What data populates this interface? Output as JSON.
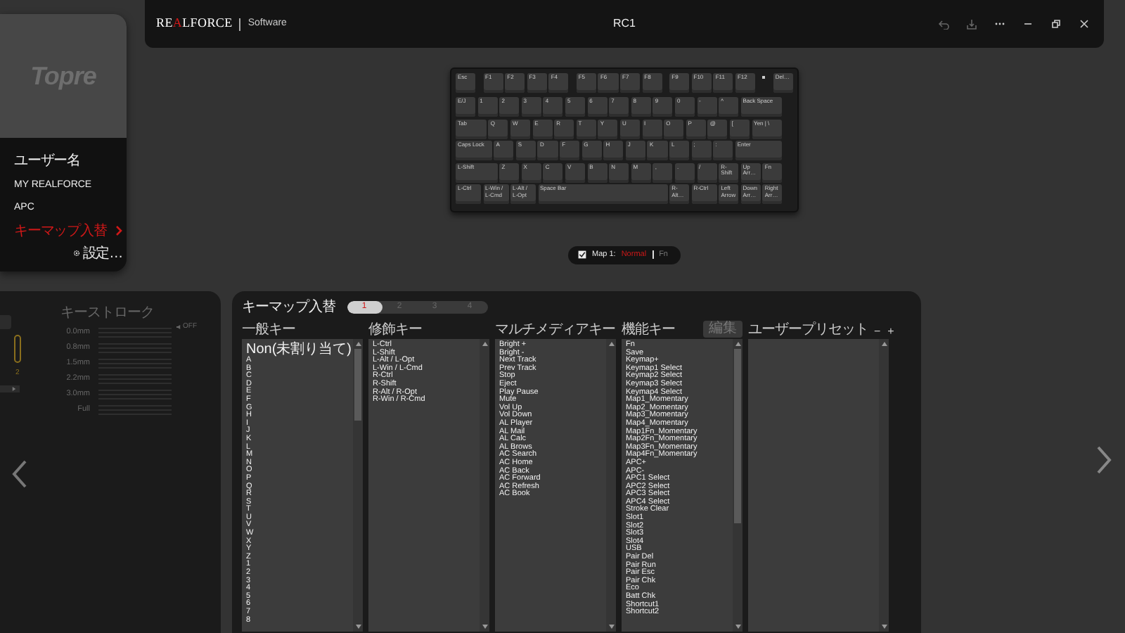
{
  "menu": {
    "logo": "Topre",
    "items": [
      {
        "label": "ユーザー名",
        "kind": "user",
        "selected": false
      },
      {
        "label": "MY REALFORCE",
        "kind": "link",
        "selected": false
      },
      {
        "label": "APC",
        "kind": "link",
        "selected": false
      },
      {
        "label": "キーマップ入替",
        "kind": "link",
        "selected": true
      },
      {
        "label": "設定…",
        "kind": "settings",
        "selected": false
      }
    ]
  },
  "title_bar": {
    "brand": [
      {
        "text": "RE",
        "accent": false
      },
      {
        "text": "A",
        "accent": true
      },
      {
        "text": "LFORCE",
        "accent": false
      }
    ],
    "product": "Software",
    "title": "RC1"
  },
  "keyboard": {
    "rows": [
      {
        "groups": [
          [
            {
              "label": "Esc",
              "kind": "key"
            }
          ],
          [
            {
              "label": "F1",
              "kind": "key"
            },
            {
              "label": "F2",
              "kind": "key"
            },
            {
              "label": "F3",
              "kind": "key"
            },
            {
              "label": "F4",
              "kind": "key"
            }
          ],
          [
            {
              "label": "F5",
              "kind": "key"
            },
            {
              "label": "F6",
              "kind": "key"
            },
            {
              "label": "F7",
              "kind": "key"
            },
            {
              "label": "F8",
              "kind": "key"
            }
          ],
          [
            {
              "label": "F9",
              "kind": "key"
            },
            {
              "label": "F10",
              "kind": "key"
            },
            {
              "label": "F11",
              "kind": "key"
            },
            {
              "label": "F12",
              "kind": "key"
            }
          ],
          [
            {
              "label": "Del…",
              "kind": "key"
            }
          ]
        ]
      },
      {
        "groups": [
          [
            {
              "label": "E/J",
              "kind": "key"
            },
            {
              "label": "1",
              "kind": "key"
            },
            {
              "label": "2",
              "kind": "key"
            },
            {
              "label": "3",
              "kind": "key"
            },
            {
              "label": "4",
              "kind": "key"
            },
            {
              "label": "5",
              "kind": "key"
            },
            {
              "label": "6",
              "kind": "key"
            },
            {
              "label": "7",
              "kind": "key"
            },
            {
              "label": "8",
              "kind": "key"
            },
            {
              "label": "9",
              "kind": "key"
            },
            {
              "label": "0",
              "kind": "key"
            },
            {
              "label": "-",
              "kind": "key"
            },
            {
              "label": "^",
              "kind": "key"
            },
            {
              "label": "Back Space",
              "kind": "backspace"
            }
          ]
        ]
      },
      {
        "groups": [
          [
            {
              "label": "Tab",
              "kind": "tab"
            },
            {
              "label": "Q",
              "kind": "key"
            },
            {
              "label": "W",
              "kind": "key"
            },
            {
              "label": "E",
              "kind": "key"
            },
            {
              "label": "R",
              "kind": "key"
            },
            {
              "label": "T",
              "kind": "key"
            },
            {
              "label": "Y",
              "kind": "key"
            },
            {
              "label": "U",
              "kind": "key"
            },
            {
              "label": "I",
              "kind": "key"
            },
            {
              "label": "O",
              "kind": "key"
            },
            {
              "label": "P",
              "kind": "key"
            },
            {
              "label": "@",
              "kind": "key"
            },
            {
              "label": "[",
              "kind": "key"
            },
            {
              "label": "Yen | \\",
              "kind": "tab"
            }
          ]
        ]
      },
      {
        "groups": [
          [
            {
              "label": "Caps Lock",
              "kind": "caps"
            },
            {
              "label": "A",
              "kind": "key"
            },
            {
              "label": "S",
              "kind": "key"
            },
            {
              "label": "D",
              "kind": "key"
            },
            {
              "label": "F",
              "kind": "key"
            },
            {
              "label": "G",
              "kind": "key"
            },
            {
              "label": "H",
              "kind": "key"
            },
            {
              "label": "J",
              "kind": "key"
            },
            {
              "label": "K",
              "kind": "key"
            },
            {
              "label": "L",
              "kind": "key"
            },
            {
              "label": ";",
              "kind": "key"
            },
            {
              "label": ":",
              "kind": "key"
            },
            {
              "label": "Enter",
              "kind": "enter"
            }
          ]
        ]
      },
      {
        "groups": [
          [
            {
              "label": "L-Shift",
              "kind": "lshift"
            },
            {
              "label": "Z",
              "kind": "key"
            },
            {
              "label": "X",
              "kind": "key"
            },
            {
              "label": "C",
              "kind": "key"
            },
            {
              "label": "V",
              "kind": "key"
            },
            {
              "label": "B",
              "kind": "key"
            },
            {
              "label": "N",
              "kind": "key"
            },
            {
              "label": "M",
              "kind": "key"
            },
            {
              "label": ",",
              "kind": "key"
            },
            {
              "label": ".",
              "kind": "key"
            },
            {
              "label": "/",
              "kind": "key"
            },
            {
              "label": "R-Shift",
              "kind": "key"
            },
            {
              "label": "Up Arr…",
              "kind": "key"
            },
            {
              "label": "Fn",
              "kind": "key"
            }
          ]
        ]
      },
      {
        "groups": [
          [
            {
              "label": "L-Ctrl",
              "kind": "mod"
            },
            {
              "label": "L-Win / L-Cmd",
              "kind": "mod"
            },
            {
              "label": "L-Alt / L-Opt",
              "kind": "mod"
            },
            {
              "label": "Space Bar",
              "kind": "space"
            },
            {
              "label": "R-Alt…",
              "kind": "key"
            },
            {
              "label": "R-Ctrl",
              "kind": "mod"
            },
            {
              "label": "Left Arrow",
              "kind": "key"
            },
            {
              "label": "Down Arr…",
              "kind": "key"
            },
            {
              "label": "Right Arr…",
              "kind": "key"
            }
          ]
        ]
      }
    ]
  },
  "map_bar": {
    "checked": true,
    "label": "Map 1:",
    "modes": [
      {
        "label": "Normal",
        "selected": true
      },
      {
        "label": "Fn",
        "selected": false
      }
    ]
  },
  "stroke_panel": {
    "partial_switch_on": false,
    "partial_label": "2",
    "title": "キーストローク",
    "rows": [
      "0.0mm",
      "0.8mm",
      "1.5mm",
      "2.2mm",
      "3.0mm",
      "Full"
    ],
    "off_label": "OFF"
  },
  "keymap_panel": {
    "title": "キーマップ入替",
    "tabs": [
      {
        "label": "1",
        "selected": true
      },
      {
        "label": "2",
        "selected": false
      },
      {
        "label": "3",
        "selected": false
      },
      {
        "label": "4",
        "selected": false
      }
    ],
    "edit_button": {
      "label": "編集",
      "disabled": true
    },
    "columns": [
      {
        "heading": "一般キー",
        "items": [
          "Non(未割り当て)",
          "A",
          "B",
          "C",
          "D",
          "E",
          "F",
          "G",
          "H",
          "I",
          "J",
          "K",
          "L",
          "M",
          "N",
          "O",
          "P",
          "Q",
          "R",
          "S",
          "T",
          "U",
          "V",
          "W",
          "X",
          "Y",
          "Z",
          "1",
          "2",
          "3",
          "4",
          "5",
          "6",
          "7",
          "8"
        ]
      },
      {
        "heading": "修飾キー",
        "items": [
          "L-Ctrl",
          "L-Shift",
          "L-Alt / L-Opt",
          "L-Win / L-Cmd",
          "R-Ctrl",
          "R-Shift",
          "R-Alt / R-Opt",
          "R-Win / R-Cmd"
        ]
      },
      {
        "heading": "マルチメディアキー",
        "items": [
          "Bright +",
          "Bright -",
          "Next Track",
          "Prev Track",
          "Stop",
          "Eject",
          "Play Pause",
          "Mute",
          "Vol Up",
          "Vol Down",
          "AL Player",
          "AL Mail",
          "AL Calc",
          "AL Brows",
          "AC Search",
          "AC Home",
          "AC Back",
          "AC Forward",
          "AC Refresh",
          "AC Book"
        ]
      },
      {
        "heading": "機能キー",
        "items": [
          "Fn",
          "Save",
          "Keymap+",
          "Keymap1 Select",
          "Keymap2 Select",
          "Keymap3 Select",
          "Keymap4 Select",
          "Map1_Momentary",
          "Map2_Momentary",
          "Map3_Momentary",
          "Map4_Momentary",
          "Map1Fn_Momentary",
          "Map2Fn_Momentary",
          "Map3Fn_Momentary",
          "Map4Fn_Momentary",
          "APC+",
          "APC-",
          "APC1 Select",
          "APC2 Select",
          "APC3 Select",
          "APC4 Select",
          "Stroke Clear",
          "Slot1",
          "Slot2",
          "Slot3",
          "Slot4",
          "USB",
          "Pair Del",
          "Pair Run",
          "Pair Esc",
          "Pair Chk",
          "Eco",
          "Batt Chk",
          "Shortcut1",
          "Shortcut2"
        ]
      },
      {
        "heading": "ユーザープリセット",
        "actions": [
          "−",
          "+"
        ]
      }
    ]
  }
}
